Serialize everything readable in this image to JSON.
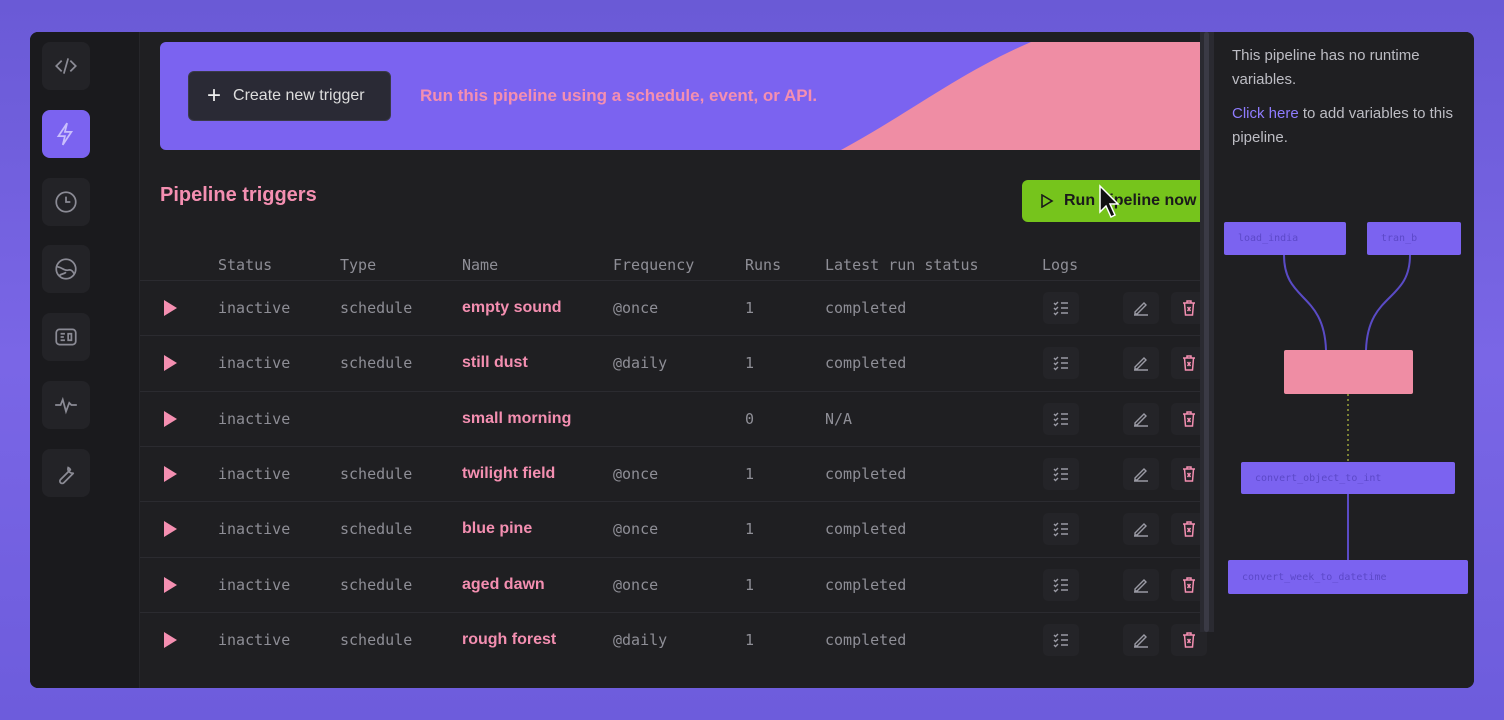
{
  "sidebar": {
    "items": [
      {
        "name": "code",
        "icon": "code-icon"
      },
      {
        "name": "triggers",
        "icon": "lightning-icon",
        "active": true
      },
      {
        "name": "runs",
        "icon": "clock-icon"
      },
      {
        "name": "backfills",
        "icon": "globe-icon"
      },
      {
        "name": "monitors",
        "icon": "tablet-icon"
      },
      {
        "name": "metrics",
        "icon": "pulse-icon"
      },
      {
        "name": "settings",
        "icon": "wrench-icon"
      }
    ]
  },
  "banner": {
    "create_label": "Create new trigger",
    "text": "Run this pipeline using a schedule, event, or API."
  },
  "section_title": "Pipeline triggers",
  "run_now_label": "Run pipeline now",
  "table": {
    "columns": [
      "Status",
      "Type",
      "Name",
      "Frequency",
      "Runs",
      "Latest run status",
      "Logs"
    ],
    "rows": [
      {
        "status": "inactive",
        "type": "schedule",
        "name": "empty sound",
        "frequency": "@once",
        "runs": "1",
        "latest": "completed"
      },
      {
        "status": "inactive",
        "type": "schedule",
        "name": "still dust",
        "frequency": "@daily",
        "runs": "1",
        "latest": "completed"
      },
      {
        "status": "inactive",
        "type": "",
        "name": "small morning",
        "frequency": "",
        "runs": "0",
        "latest": "N/A"
      },
      {
        "status": "inactive",
        "type": "schedule",
        "name": "twilight field",
        "frequency": "@once",
        "runs": "1",
        "latest": "completed"
      },
      {
        "status": "inactive",
        "type": "schedule",
        "name": "blue pine",
        "frequency": "@once",
        "runs": "1",
        "latest": "completed"
      },
      {
        "status": "inactive",
        "type": "schedule",
        "name": "aged dawn",
        "frequency": "@once",
        "runs": "1",
        "latest": "completed"
      },
      {
        "status": "inactive",
        "type": "schedule",
        "name": "rough forest",
        "frequency": "@daily",
        "runs": "1",
        "latest": "completed"
      }
    ]
  },
  "right_panel": {
    "line1": "This pipeline has no runtime variables.",
    "link": "Click here",
    "line2_rest": " to add variables to this pipeline.",
    "nodes": [
      {
        "label": "load_india"
      },
      {
        "label": "tran_b"
      },
      {
        "label": ""
      },
      {
        "label": "convert_object_to_int"
      },
      {
        "label": "convert_week_to_datetime"
      }
    ]
  },
  "colors": {
    "accent": "#7b63f0",
    "pink": "#f48fb1",
    "green": "#76c41c",
    "background": "#1f1f22"
  }
}
